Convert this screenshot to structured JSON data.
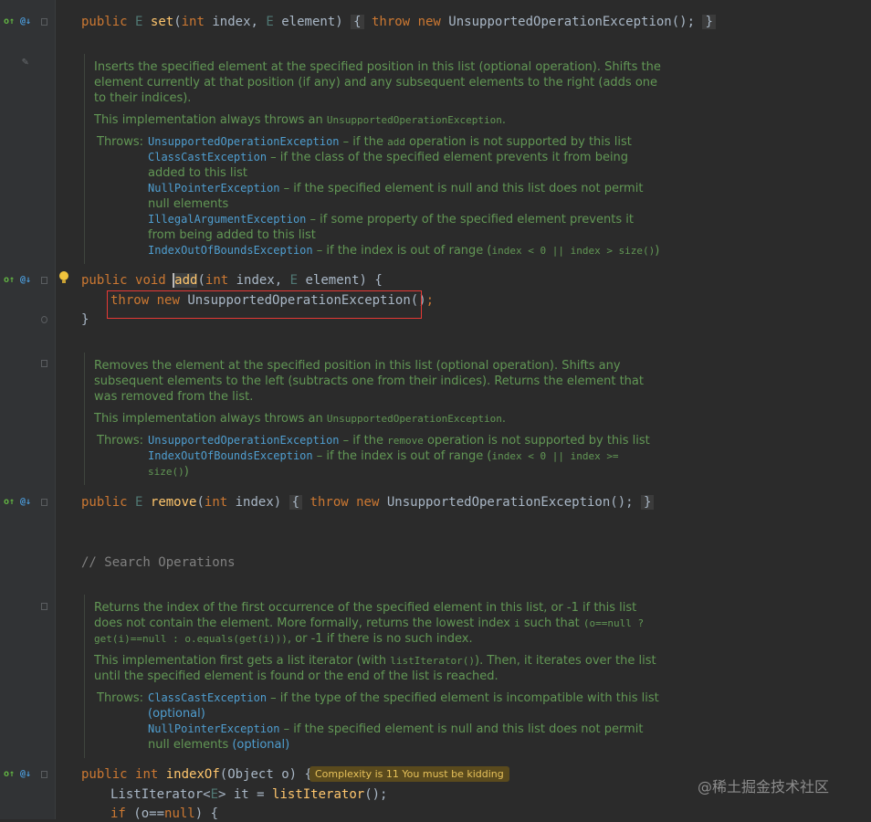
{
  "code": {
    "set": {
      "kw_public": "public",
      "type_e": "E",
      "fn": "set",
      "open": "(",
      "kw_int": "int",
      "p1": " index, ",
      "type_e2": "E",
      "p2": " element)",
      "brace_open": "{",
      "kw_throw": "throw",
      "kw_new": "new",
      "exc": "UnsupportedOperationException();",
      "brace_close": "}"
    },
    "add": {
      "kw_public": "public",
      "kw_void": "void",
      "fn": "add",
      "open": "(",
      "kw_int": "int",
      "p1": " index, ",
      "type_e": "E",
      "p2": " element) {",
      "body_kw_throw": "throw",
      "body_kw_new": "new",
      "body_exc": "UnsupportedOperationException()",
      "body_semi": ";",
      "close": "}"
    },
    "remove": {
      "kw_public": "public",
      "type_e": "E",
      "fn": "remove",
      "open": "(",
      "kw_int": "int",
      "p1": " index)",
      "brace_open": "{",
      "kw_throw": "throw",
      "kw_new": "new",
      "exc": "UnsupportedOperationException();",
      "brace_close": "}"
    },
    "search_comment": "// Search Operations",
    "indexOf": {
      "kw_public": "public",
      "kw_int": "int",
      "fn": "indexOf",
      "p1": "(Object o) {",
      "line2_a": "ListIterator<",
      "line2_e": "E",
      "line2_b": "> it = ",
      "line2_fn": "listIterator",
      "line2_c": "();",
      "line3_kw_if": "if",
      "line3_a": " (o==",
      "line3_kw_null": "null",
      "line3_b": ") {"
    }
  },
  "doc_add": {
    "p1": "Inserts the specified element at the specified position in this list (optional operation). Shifts the element currently at that position (if any) and any subsequent elements to the right (adds one to their indices).",
    "p2_a": "This implementation always throws an ",
    "p2_code": "UnsupportedOperationException",
    "p2_b": ".",
    "throws_label": "Throws:",
    "t1_link": "UnsupportedOperationException",
    "t1_a": " – if the ",
    "t1_code": "add",
    "t1_b": " operation is not supported by this list",
    "t2_link": "ClassCastException",
    "t2_text": " – if the class of the specified element prevents it from being added to this list",
    "t3_link": "NullPointerException",
    "t3_text": " – if the specified element is null and this list does not permit null elements",
    "t4_link": "IllegalArgumentException",
    "t4_text": " – if some property of the specified element prevents it from being added to this list",
    "t5_link": "IndexOutOfBoundsException",
    "t5_a": " – if the index is out of range (",
    "t5_code": "index < 0 || index > size()",
    "t5_b": ")"
  },
  "doc_remove": {
    "p1": "Removes the element at the specified position in this list (optional operation). Shifts any subsequent elements to the left (subtracts one from their indices). Returns the element that was removed from the list.",
    "p2_a": "This implementation always throws an ",
    "p2_code": "UnsupportedOperationException",
    "p2_b": ".",
    "throws_label": "Throws:",
    "t1_link": "UnsupportedOperationException",
    "t1_a": " – if the ",
    "t1_code": "remove",
    "t1_b": " operation is not supported by this list",
    "t2_link": "IndexOutOfBoundsException",
    "t2_a": " – if the index is out of range (",
    "t2_code": "index < 0 || index >= size()",
    "t2_b": ")"
  },
  "doc_indexof": {
    "p1_a": "Returns the index of the first occurrence of the specified element in this list, or -1 if this list does not contain the element. More formally, returns the lowest index ",
    "p1_code1": "i",
    "p1_b": " such that ",
    "p1_code2": "(o==null ? get(i)==null : o.equals(get(i)))",
    "p1_c": ", or -1 if there is no such index.",
    "p2_a": "This implementation first gets a list iterator (with ",
    "p2_code": "listIterator()",
    "p2_b": "). Then, it iterates over the list until the specified element is found or the end of the list is reached.",
    "throws_label": "Throws:",
    "t1_link": "ClassCastException",
    "t1_text": " – if the type of the specified element is incompatible with this list ",
    "t1_opt": "(optional)",
    "t2_link": "NullPointerException",
    "t2_text": " – if the specified element is null and this list does not permit null elements ",
    "t2_opt": "(optional)"
  },
  "badge": "Complexity is 11 You must be kidding",
  "watermark": "@稀土掘金技术社区",
  "gutter": {
    "override_icon": "o↑",
    "annotation_icon": "@↓"
  },
  "colors": {
    "background": "#2b2b2b",
    "keyword": "#cc7832",
    "function": "#ffc66d",
    "doc": "#629755",
    "link": "#4f9ed0",
    "highlight_box": "#e53935"
  }
}
